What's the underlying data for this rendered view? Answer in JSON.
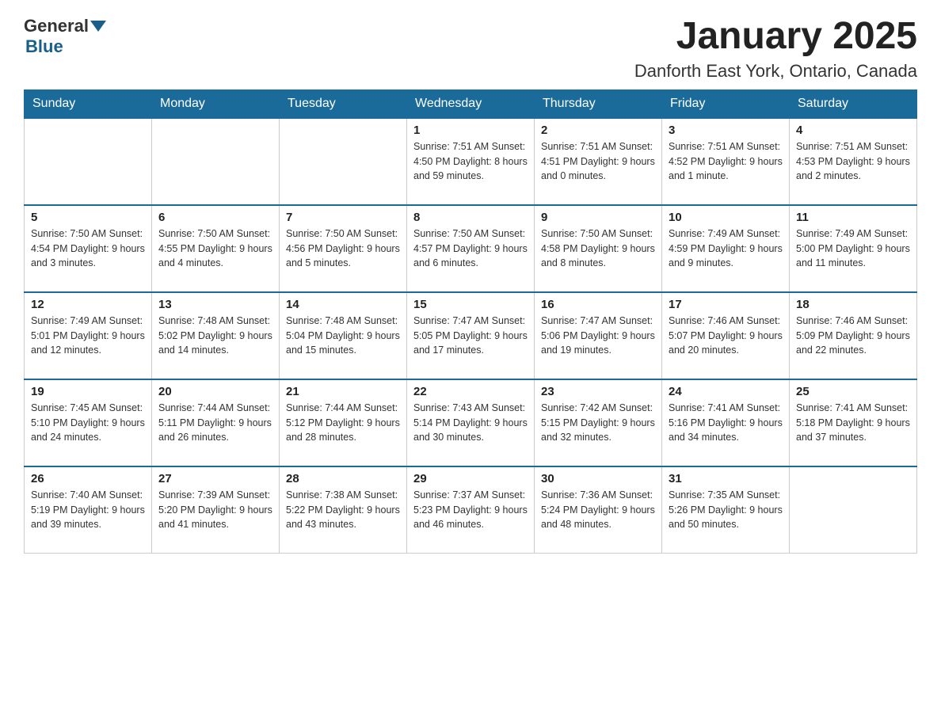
{
  "logo": {
    "general": "General",
    "blue": "Blue"
  },
  "title": "January 2025",
  "subtitle": "Danforth East York, Ontario, Canada",
  "days_of_week": [
    "Sunday",
    "Monday",
    "Tuesday",
    "Wednesday",
    "Thursday",
    "Friday",
    "Saturday"
  ],
  "weeks": [
    [
      {
        "day": "",
        "info": ""
      },
      {
        "day": "",
        "info": ""
      },
      {
        "day": "",
        "info": ""
      },
      {
        "day": "1",
        "info": "Sunrise: 7:51 AM\nSunset: 4:50 PM\nDaylight: 8 hours\nand 59 minutes."
      },
      {
        "day": "2",
        "info": "Sunrise: 7:51 AM\nSunset: 4:51 PM\nDaylight: 9 hours\nand 0 minutes."
      },
      {
        "day": "3",
        "info": "Sunrise: 7:51 AM\nSunset: 4:52 PM\nDaylight: 9 hours\nand 1 minute."
      },
      {
        "day": "4",
        "info": "Sunrise: 7:51 AM\nSunset: 4:53 PM\nDaylight: 9 hours\nand 2 minutes."
      }
    ],
    [
      {
        "day": "5",
        "info": "Sunrise: 7:50 AM\nSunset: 4:54 PM\nDaylight: 9 hours\nand 3 minutes."
      },
      {
        "day": "6",
        "info": "Sunrise: 7:50 AM\nSunset: 4:55 PM\nDaylight: 9 hours\nand 4 minutes."
      },
      {
        "day": "7",
        "info": "Sunrise: 7:50 AM\nSunset: 4:56 PM\nDaylight: 9 hours\nand 5 minutes."
      },
      {
        "day": "8",
        "info": "Sunrise: 7:50 AM\nSunset: 4:57 PM\nDaylight: 9 hours\nand 6 minutes."
      },
      {
        "day": "9",
        "info": "Sunrise: 7:50 AM\nSunset: 4:58 PM\nDaylight: 9 hours\nand 8 minutes."
      },
      {
        "day": "10",
        "info": "Sunrise: 7:49 AM\nSunset: 4:59 PM\nDaylight: 9 hours\nand 9 minutes."
      },
      {
        "day": "11",
        "info": "Sunrise: 7:49 AM\nSunset: 5:00 PM\nDaylight: 9 hours\nand 11 minutes."
      }
    ],
    [
      {
        "day": "12",
        "info": "Sunrise: 7:49 AM\nSunset: 5:01 PM\nDaylight: 9 hours\nand 12 minutes."
      },
      {
        "day": "13",
        "info": "Sunrise: 7:48 AM\nSunset: 5:02 PM\nDaylight: 9 hours\nand 14 minutes."
      },
      {
        "day": "14",
        "info": "Sunrise: 7:48 AM\nSunset: 5:04 PM\nDaylight: 9 hours\nand 15 minutes."
      },
      {
        "day": "15",
        "info": "Sunrise: 7:47 AM\nSunset: 5:05 PM\nDaylight: 9 hours\nand 17 minutes."
      },
      {
        "day": "16",
        "info": "Sunrise: 7:47 AM\nSunset: 5:06 PM\nDaylight: 9 hours\nand 19 minutes."
      },
      {
        "day": "17",
        "info": "Sunrise: 7:46 AM\nSunset: 5:07 PM\nDaylight: 9 hours\nand 20 minutes."
      },
      {
        "day": "18",
        "info": "Sunrise: 7:46 AM\nSunset: 5:09 PM\nDaylight: 9 hours\nand 22 minutes."
      }
    ],
    [
      {
        "day": "19",
        "info": "Sunrise: 7:45 AM\nSunset: 5:10 PM\nDaylight: 9 hours\nand 24 minutes."
      },
      {
        "day": "20",
        "info": "Sunrise: 7:44 AM\nSunset: 5:11 PM\nDaylight: 9 hours\nand 26 minutes."
      },
      {
        "day": "21",
        "info": "Sunrise: 7:44 AM\nSunset: 5:12 PM\nDaylight: 9 hours\nand 28 minutes."
      },
      {
        "day": "22",
        "info": "Sunrise: 7:43 AM\nSunset: 5:14 PM\nDaylight: 9 hours\nand 30 minutes."
      },
      {
        "day": "23",
        "info": "Sunrise: 7:42 AM\nSunset: 5:15 PM\nDaylight: 9 hours\nand 32 minutes."
      },
      {
        "day": "24",
        "info": "Sunrise: 7:41 AM\nSunset: 5:16 PM\nDaylight: 9 hours\nand 34 minutes."
      },
      {
        "day": "25",
        "info": "Sunrise: 7:41 AM\nSunset: 5:18 PM\nDaylight: 9 hours\nand 37 minutes."
      }
    ],
    [
      {
        "day": "26",
        "info": "Sunrise: 7:40 AM\nSunset: 5:19 PM\nDaylight: 9 hours\nand 39 minutes."
      },
      {
        "day": "27",
        "info": "Sunrise: 7:39 AM\nSunset: 5:20 PM\nDaylight: 9 hours\nand 41 minutes."
      },
      {
        "day": "28",
        "info": "Sunrise: 7:38 AM\nSunset: 5:22 PM\nDaylight: 9 hours\nand 43 minutes."
      },
      {
        "day": "29",
        "info": "Sunrise: 7:37 AM\nSunset: 5:23 PM\nDaylight: 9 hours\nand 46 minutes."
      },
      {
        "day": "30",
        "info": "Sunrise: 7:36 AM\nSunset: 5:24 PM\nDaylight: 9 hours\nand 48 minutes."
      },
      {
        "day": "31",
        "info": "Sunrise: 7:35 AM\nSunset: 5:26 PM\nDaylight: 9 hours\nand 50 minutes."
      },
      {
        "day": "",
        "info": ""
      }
    ]
  ]
}
